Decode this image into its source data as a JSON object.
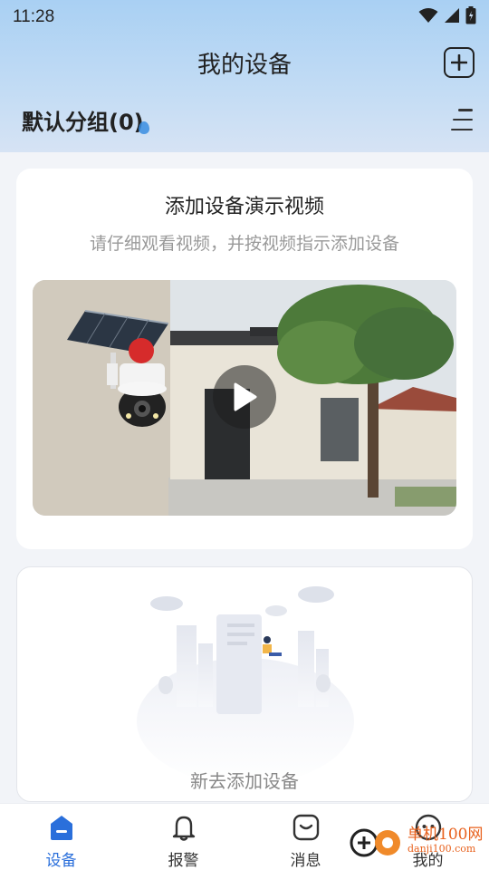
{
  "status_bar": {
    "time": "11:28",
    "icons": [
      "wifi-icon",
      "signal-icon",
      "battery-icon"
    ]
  },
  "header": {
    "title": "我的设备",
    "add_icon": "add-square-icon"
  },
  "group": {
    "label": "默认分组(0)",
    "menu_icon": "menu-lines-icon"
  },
  "video_card": {
    "title": "添加设备演示视频",
    "subtitle": "请仔细观看视频，并按视频指示添加设备",
    "play_icon": "play-icon"
  },
  "empty_card": {
    "text": "新去添加设备"
  },
  "tabs": [
    {
      "label": "设备",
      "icon": "device-home-icon",
      "active": true
    },
    {
      "label": "报警",
      "icon": "bell-icon",
      "active": false
    },
    {
      "label": "消息",
      "icon": "message-icon",
      "active": false
    },
    {
      "label": "我的",
      "icon": "profile-icon",
      "active": false
    }
  ],
  "watermark": {
    "line1": "单机100网",
    "line2": "danji100.com"
  },
  "colors": {
    "accent": "#2a6fdb",
    "header_gradient_top": "#a9d0f3",
    "header_gradient_bottom": "#d6e3f4",
    "watermark": "#e8611d"
  }
}
